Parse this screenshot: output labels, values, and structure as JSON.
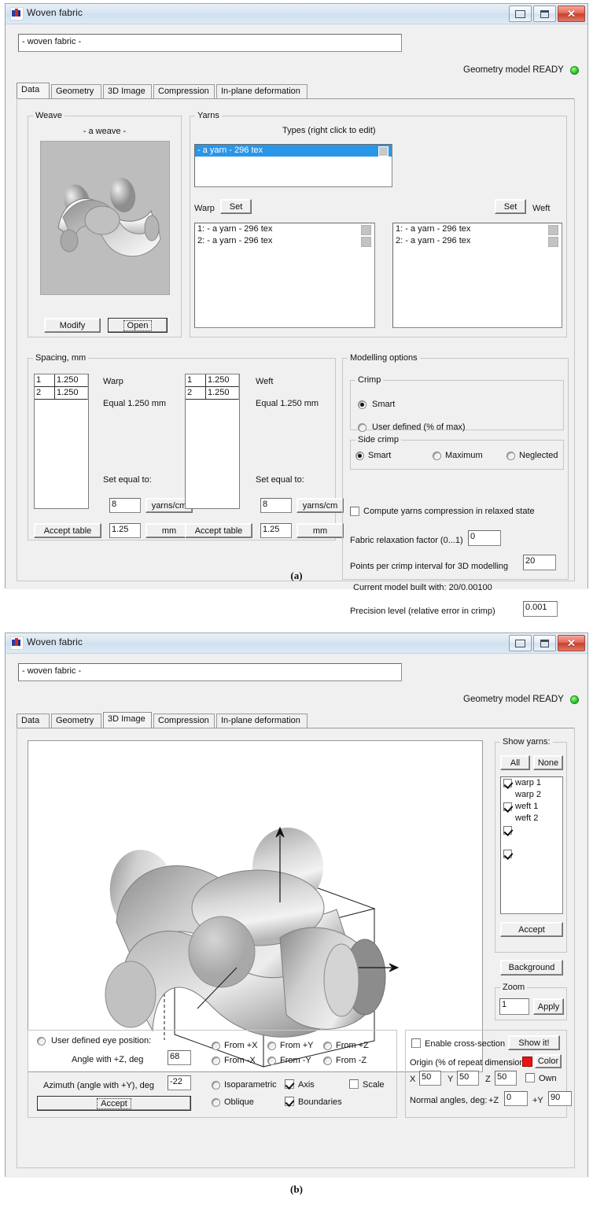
{
  "figures": {
    "a_caption": "(a)",
    "b_caption": "(b)"
  },
  "window": {
    "title": "Woven fabric",
    "icon": "app-icon",
    "buttons": {
      "minimize": "minimize",
      "maximize": "maximize",
      "close": "close"
    },
    "name_field_value": "- woven fabric -",
    "status_text": "Geometry model READY",
    "status_led_color": "#2ec22e",
    "tabs": [
      "Data",
      "Geometry",
      "3D Image",
      "Compression",
      "In-plane deformation"
    ]
  },
  "panel_a": {
    "active_tab": "Data",
    "weave": {
      "group_label": "Weave",
      "name": "- a weave -",
      "modify_button": "Modify",
      "open_button": "Open"
    },
    "yarns": {
      "group_label": "Yarns",
      "types_label": "Types (right click to edit)",
      "types": [
        "- a yarn - 296 tex"
      ],
      "warp_label": "Warp",
      "weft_label": "Weft",
      "warp_set_button": "Set",
      "weft_set_button": "Set",
      "warp_list": [
        "1: - a yarn - 296 tex",
        "2: - a yarn - 296 tex"
      ],
      "weft_list": [
        "1: - a yarn - 296 tex",
        "2: - a yarn - 296 tex"
      ]
    },
    "spacing": {
      "group_label": "Spacing, mm",
      "warp": {
        "title": "Warp",
        "rows": [
          {
            "index": "1",
            "value": "1.250"
          },
          {
            "index": "2",
            "value": "1.250"
          }
        ],
        "equal_text": "Equal 1.250 mm",
        "set_equal_label": "Set equal to:",
        "density_value": "8",
        "density_unit_button": "yarns/cm",
        "accept_button": "Accept table",
        "spacing_value": "1.25",
        "spacing_unit_button": "mm"
      },
      "weft": {
        "title": "Weft",
        "rows": [
          {
            "index": "1",
            "value": "1.250"
          },
          {
            "index": "2",
            "value": "1.250"
          }
        ],
        "equal_text": "Equal 1.250 mm",
        "set_equal_label": "Set equal to:",
        "density_value": "8",
        "density_unit_button": "yarns/cm",
        "accept_button": "Accept table",
        "spacing_value": "1.25",
        "spacing_unit_button": "mm"
      }
    },
    "modelling": {
      "group_label": "Modelling options",
      "crimp": {
        "group_label": "Crimp",
        "options": [
          "Smart",
          "User defined (% of max)"
        ],
        "selected": "Smart"
      },
      "side_crimp": {
        "group_label": "Side crimp",
        "options": [
          "Smart",
          "Maximum",
          "Neglected"
        ],
        "selected": "Smart"
      },
      "compute_compression_label": "Compute yarns compression in relaxed state",
      "compute_compression_checked": false,
      "relaxation_label": "Fabric relaxation factor (0...1)",
      "relaxation_value": "0",
      "points_label": "Points per crimp interval for 3D modelling",
      "points_value": "20",
      "current_model_text": "Current model built with: 20/0.00100",
      "precision_label": "Precision level (relative error in crimp)",
      "precision_value": "0.001"
    }
  },
  "panel_b": {
    "active_tab": "3D Image",
    "show_yarns": {
      "group_label": "Show yarns:",
      "all_button": "All",
      "none_button": "None",
      "items": [
        {
          "label": "warp 1",
          "checked": true
        },
        {
          "label": "warp 2",
          "checked": true
        },
        {
          "label": "weft 1",
          "checked": true
        },
        {
          "label": "weft 2",
          "checked": true
        }
      ],
      "accept_button": "Accept"
    },
    "background_button": "Background",
    "zoom": {
      "group_label": "Zoom",
      "value": "1",
      "apply_button": "Apply"
    },
    "eye": {
      "user_defined_label": "User defined eye position:",
      "user_defined_selected": false,
      "angle_z_label": "Angle with +Z, deg",
      "angle_z_value": "68",
      "azimuth_label": "Azimuth (angle with +Y), deg",
      "azimuth_value": "-22",
      "accept_button": "Accept"
    },
    "views": {
      "options": [
        "From +X",
        "From +Y",
        "From +Z",
        "From -X",
        "From -Y",
        "From -Z"
      ],
      "projection": [
        "Isoparametric",
        "Oblique"
      ],
      "checks": [
        {
          "label": "Axis",
          "checked": true
        },
        {
          "label": "Scale",
          "checked": false
        },
        {
          "label": "Boundaries",
          "checked": true
        }
      ]
    },
    "cross_section": {
      "enable_label": "Enable cross-section",
      "enable_checked": false,
      "show_button": "Show it!",
      "origin_label": "Origin (% of repeat dimensions)",
      "color_button": "Color",
      "color_swatch": "#ee1111",
      "own_label": "Own",
      "own_checked": false,
      "axes": [
        {
          "label": "X",
          "value": "50"
        },
        {
          "label": "Y",
          "value": "50"
        },
        {
          "label": "Z",
          "value": "50"
        }
      ],
      "normal_label": "Normal angles, deg:",
      "normals": [
        {
          "label": "+Z",
          "value": "0"
        },
        {
          "label": "+Y",
          "value": "90"
        }
      ]
    }
  }
}
